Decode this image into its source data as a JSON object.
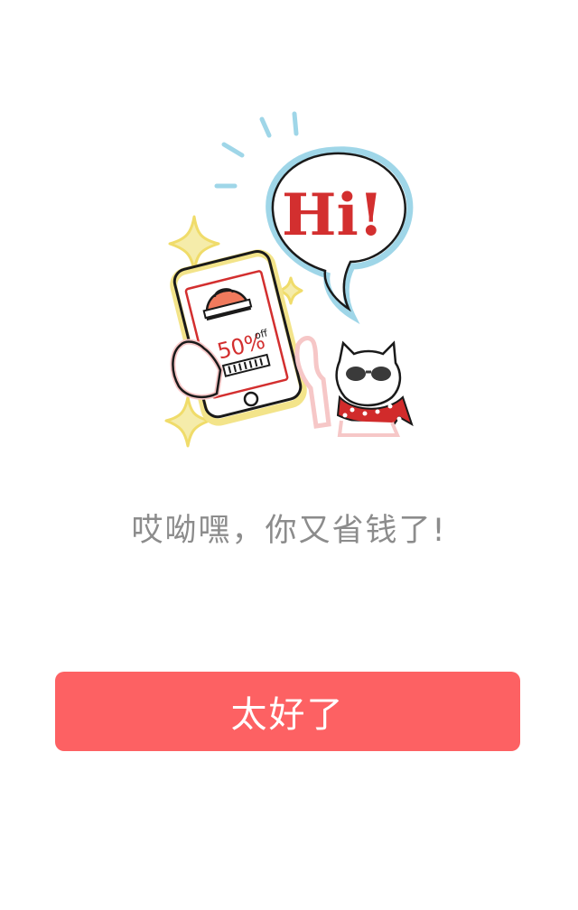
{
  "illustration": {
    "speech_text": "Hi!",
    "discount_text": "50%",
    "discount_suffix": "off",
    "colors": {
      "speech_text": "#d32f2f",
      "speech_bubble_outline": "#9fd6e8",
      "sparkle": "#f2e27d",
      "phone_frame": "#f3e48a",
      "scarf": "#d12b2b"
    }
  },
  "message": {
    "text": "哎呦嘿，你又省钱了!"
  },
  "confirm_button": {
    "label": "太好了",
    "color": "#fd6163"
  }
}
